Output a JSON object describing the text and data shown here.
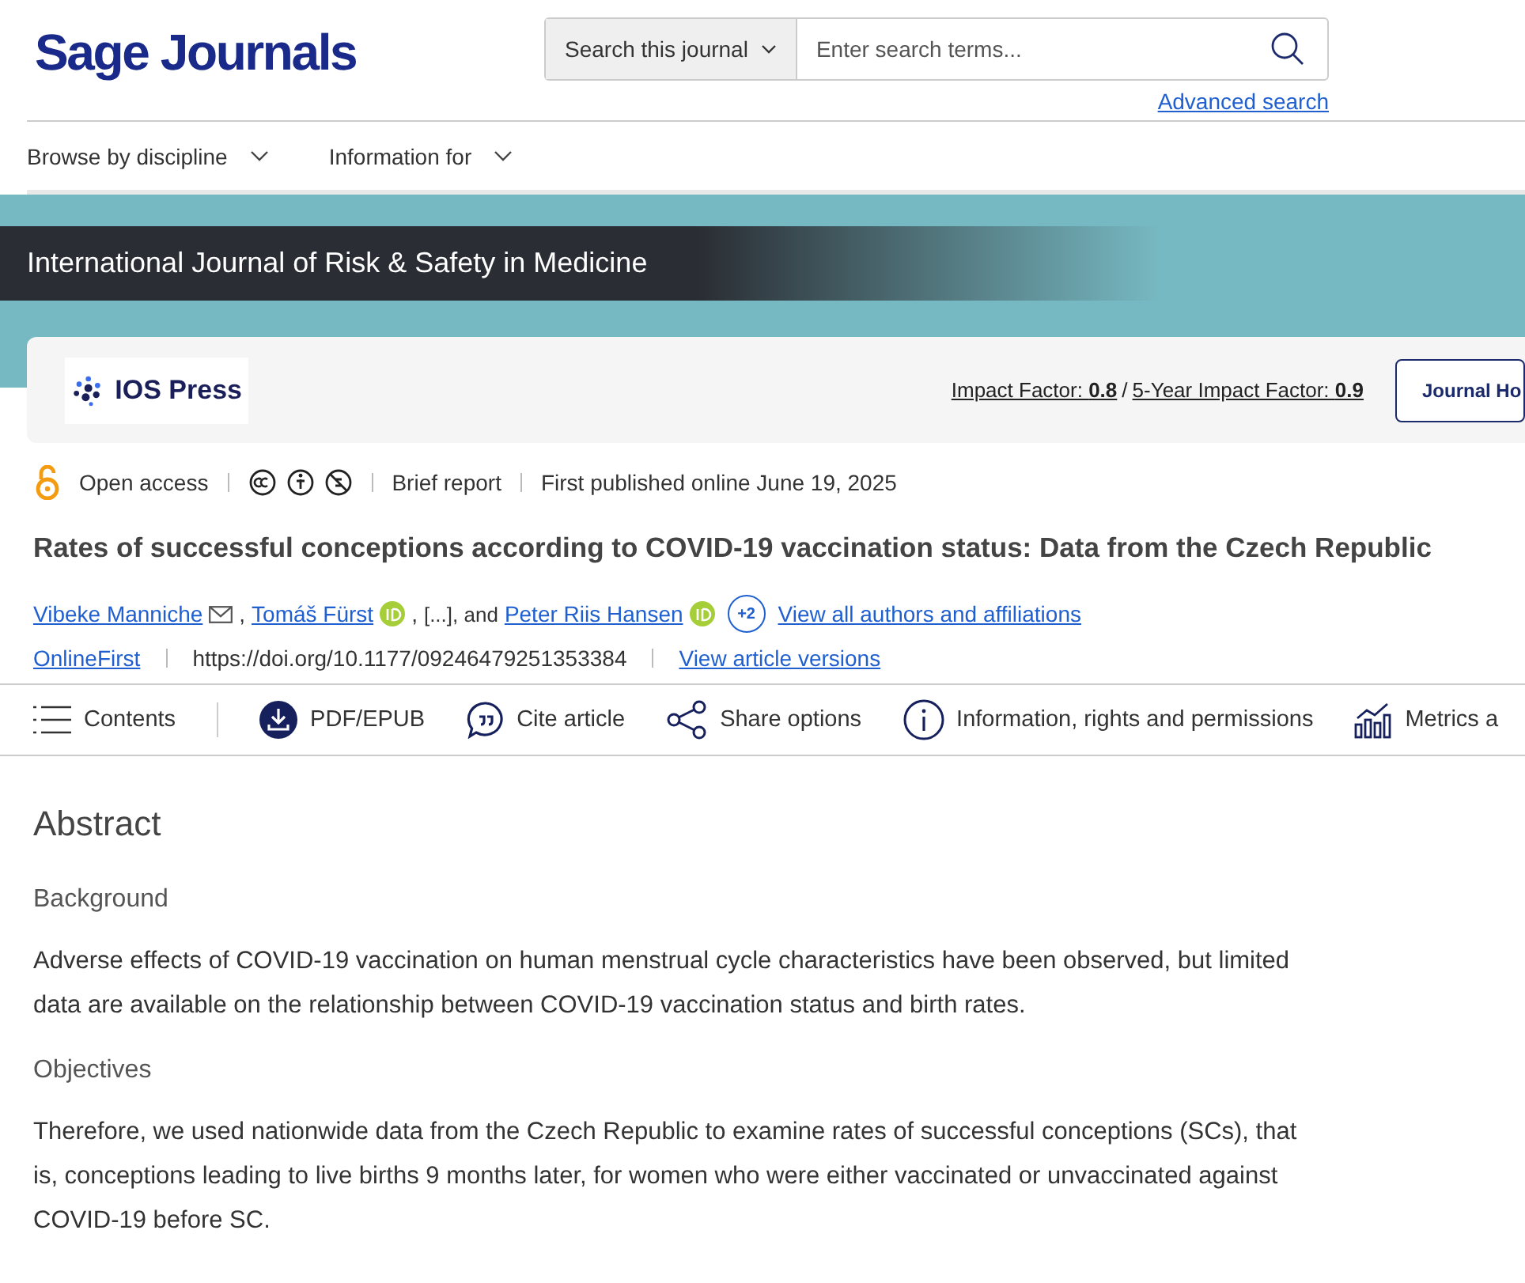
{
  "header": {
    "logo": "Sage Journals",
    "search_scope": "Search this journal",
    "search_placeholder": "Enter search terms...",
    "advanced_search": "Advanced search"
  },
  "nav": [
    {
      "label": "Browse by discipline"
    },
    {
      "label": "Information for"
    }
  ],
  "journal": {
    "title": "International Journal of Risk & Safety in Medicine",
    "publisher": "IOS Press",
    "impact_factor": "Impact Factor: **0.8** ",
    "impact_separator": "/",
    "five_year_impact_factor": "5-Year Impact Factor: **0.9**",
    "home_button": "Journal Ho"
  },
  "meta": {
    "access": "Open access",
    "article_type": "Brief report",
    "published": "First published online June 19, 2025"
  },
  "article": {
    "title": "Rates of successful conceptions according to COVID-19 vaccination status: Data from the Czech Republic",
    "authors": [
      {
        "kind": "link",
        "name": "Vibeke Manniche",
        "email": true,
        "orcid": false,
        "sep": ","
      },
      {
        "kind": "link",
        "name": "Tomáš Fürst",
        "email": false,
        "orcid": true,
        "sep": ","
      },
      {
        "kind": "text",
        "name": "[...], and",
        "email": false,
        "orcid": false
      },
      {
        "kind": "link",
        "name": "Peter Riis Hansen",
        "email": false,
        "orcid": true
      }
    ],
    "more_authors": "+2",
    "all_authors": "View all authors and affiliations",
    "status": "OnlineFirst",
    "doi": "https://doi.org/10.1177/09246479251353384",
    "versions": "View article versions"
  },
  "toolbar": [
    {
      "kind": "menu",
      "label": "Contents"
    },
    {
      "kind": "download",
      "label": "PDF/EPUB"
    },
    {
      "kind": "cite",
      "label": "Cite article"
    },
    {
      "kind": "share",
      "label": "Share options"
    },
    {
      "kind": "info",
      "label": "Information, rights and permissions"
    },
    {
      "kind": "metrics",
      "label": "Metrics a"
    }
  ],
  "abstract": {
    "heading": "Abstract",
    "sections": [
      {
        "heading": "Background",
        "text": "Adverse effects of COVID-19 vaccination on human menstrual cycle characteristics have been observed, but limited data are available on the relationship between COVID-19 vaccination status and birth rates."
      },
      {
        "heading": "Objectives",
        "text": "Therefore, we used nationwide data from the Czech Republic to examine rates of successful conceptions (SCs), that is, conceptions leading to live births 9 months later, for women who were either vaccinated or unvaccinated against COVID-19 before SC."
      }
    ]
  }
}
